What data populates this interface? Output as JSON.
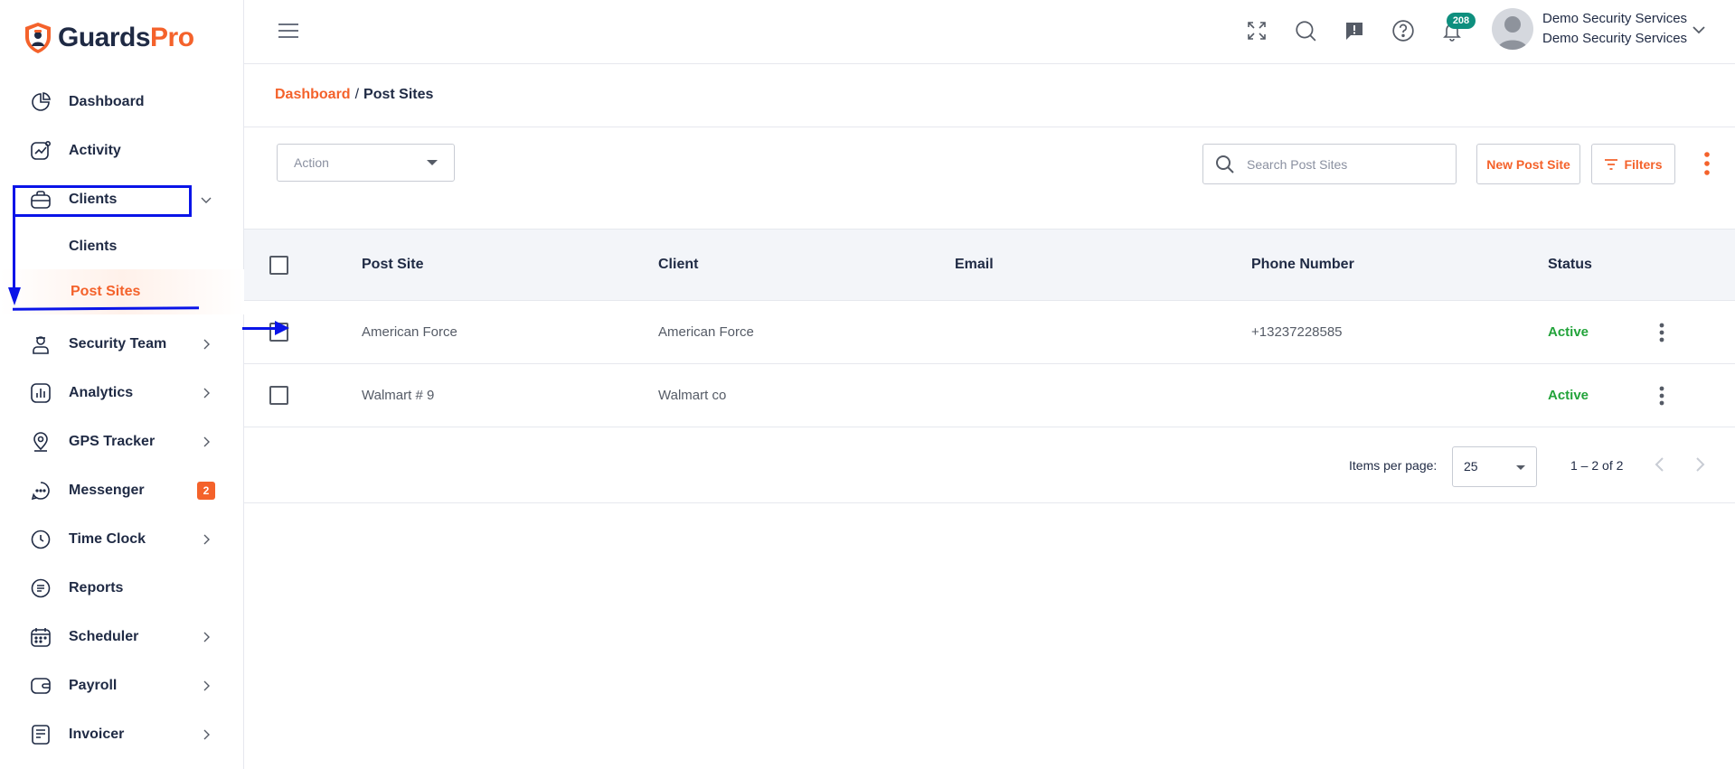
{
  "brand": {
    "name_part1": "Guards",
    "name_part2": "Pro",
    "accent": "#f4622b"
  },
  "sidebar": {
    "items": [
      {
        "label": "Dashboard",
        "icon": "pie-chart-icon"
      },
      {
        "label": "Activity",
        "icon": "activity-icon"
      },
      {
        "label": "Clients",
        "icon": "briefcase-icon",
        "expanded": true,
        "children": [
          {
            "label": "Clients"
          },
          {
            "label": "Post Sites",
            "active": true
          }
        ]
      },
      {
        "label": "Security Team",
        "icon": "guard-icon"
      },
      {
        "label": "Analytics",
        "icon": "analytics-icon"
      },
      {
        "label": "GPS Tracker",
        "icon": "location-pin-icon"
      },
      {
        "label": "Messenger",
        "icon": "chat-icon",
        "badge": "2"
      },
      {
        "label": "Time Clock",
        "icon": "clock-icon"
      },
      {
        "label": "Reports",
        "icon": "report-icon"
      },
      {
        "label": "Scheduler",
        "icon": "calendar-icon"
      },
      {
        "label": "Payroll",
        "icon": "wallet-icon"
      },
      {
        "label": "Invoicer",
        "icon": "invoice-icon"
      }
    ]
  },
  "topbar": {
    "notifications_count": "208",
    "user_name": "Demo Security Services",
    "user_org": "Demo Security Services"
  },
  "breadcrumb": {
    "parent": "Dashboard",
    "separator": "/",
    "current": "Post Sites"
  },
  "toolbar": {
    "action_label": "Action",
    "search_placeholder": "Search Post Sites",
    "new_button": "New Post Site",
    "filters_button": "Filters"
  },
  "table": {
    "headers": [
      "Post Site",
      "Client",
      "Email",
      "Phone Number",
      "Status"
    ],
    "rows": [
      {
        "post_site": "American Force",
        "client": "American Force",
        "email": "",
        "phone": "+13237228585",
        "status": "Active"
      },
      {
        "post_site": "Walmart # 9",
        "client": "Walmart co",
        "email": "",
        "phone": "",
        "status": "Active"
      }
    ]
  },
  "paginator": {
    "items_per_page_label": "Items per page:",
    "items_per_page": "25",
    "range": "1 – 2 of 2"
  },
  "colors": {
    "status_active": "#22a33a",
    "annotation": "#0a14e8",
    "badge_teal": "#0e8f7e"
  }
}
